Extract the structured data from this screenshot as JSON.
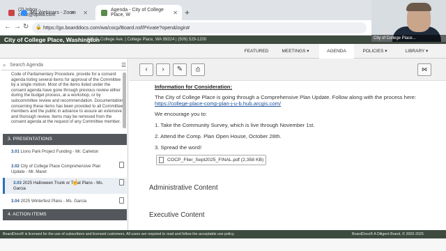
{
  "browser": {
    "tabs": [
      {
        "label": "(2) Inbox - chaz@cpwa.com"
      },
      {
        "label": "My Webinars - Zoom"
      },
      {
        "label": "Agenda - City of College Place, W"
      }
    ],
    "url": "https://go.boarddocs.com/wa/cocp/Board.nsf/Private?open&login#"
  },
  "webcam": {
    "label": "City of College Place..."
  },
  "site": {
    "title": "City of College Place, Washington",
    "address": "625 S. College Ave. | College Place, WA 99324 | (509) 529-1200",
    "nav": [
      "FEATURED",
      "MEETINGS ▾",
      "AGENDA",
      "POLICIES ▾",
      "LIBRARY ▾"
    ]
  },
  "left": {
    "search_placeholder": "Search Agenda",
    "body": "Code of Parliamentary Procedure, provide for a consent agenda listing several items for approval of the Committee by a single motion. Most of the items listed under the consent agenda have gone through previous review either during the budget process, at a workshop, or by subcommittee review and recommendation. Documentation concerning these items has been provided to all Committee members and the public in advance to assure an extensive and thorough review. Items may be removed from the consent agenda at the request of any Committee member.",
    "section3": "3. PRESENTATIONS",
    "items": [
      {
        "num": "3.01",
        "text": "Lions Park Project Funding - Mr. Carleton"
      },
      {
        "num": "3.02",
        "text": "City of College Place Comprehensive Plan Update - Mr. Maret"
      },
      {
        "num": "3.03",
        "text": "2025 Halloween Trunk or Treat Plans - Ms. Garcia"
      },
      {
        "num": "3.04",
        "text": "2025 Winterfest Plans - Ms. Garcia"
      }
    ],
    "section4": "4. ACTION ITEMS"
  },
  "main": {
    "info_head": "Information for Consideration:",
    "para1": "The City of College Place is going through a Comprehensive Plan Update. Follow along with the process here: ",
    "link": "https://college-place-comp-plan-j-u-b.hub.arcgis.com/",
    "encourage": "We encourage you to:",
    "list": [
      "1. Take the Community Survey, which is live through November 1st.",
      "2. Attend the Comp. Plan Open House, October 28th.",
      "3. Spread the word!"
    ],
    "attachment": "COCP_Flier_Sept2025_FINAL.pdf (2,358 KB)",
    "admin": "Administrative Content",
    "exec": "Executive Content"
  },
  "footer": {
    "left": "BoardDocs® is licensed for the use of subscribers and licensed customers. All users are required to read and follow the acceptable use policy.",
    "right": "BoardDocs® A Diligent Brand, © 2002-2025"
  }
}
